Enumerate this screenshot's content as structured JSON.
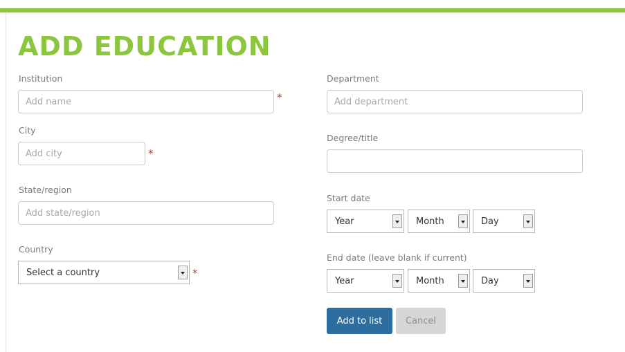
{
  "title": "ADD EDUCATION",
  "form": {
    "institution": {
      "label": "Institution",
      "placeholder": "Add name",
      "value": ""
    },
    "city": {
      "label": "City",
      "placeholder": "Add city",
      "value": ""
    },
    "state": {
      "label": "State/region",
      "placeholder": "Add state/region",
      "value": ""
    },
    "country": {
      "label": "Country",
      "selected": "Select a country"
    },
    "department": {
      "label": "Department",
      "placeholder": "Add department",
      "value": ""
    },
    "degree": {
      "label": "Degree/title",
      "placeholder": "",
      "value": ""
    },
    "start_date": {
      "label": "Start date",
      "year": "Year",
      "month": "Month",
      "day": "Day"
    },
    "end_date": {
      "label": "End date (leave blank if current)",
      "year": "Year",
      "month": "Month",
      "day": "Day"
    },
    "required_mark": "*"
  },
  "buttons": {
    "add": "Add to list",
    "cancel": "Cancel"
  },
  "colors": {
    "accent": "#8cc63f",
    "primary": "#2e6e9e",
    "required": "#c0392b"
  }
}
